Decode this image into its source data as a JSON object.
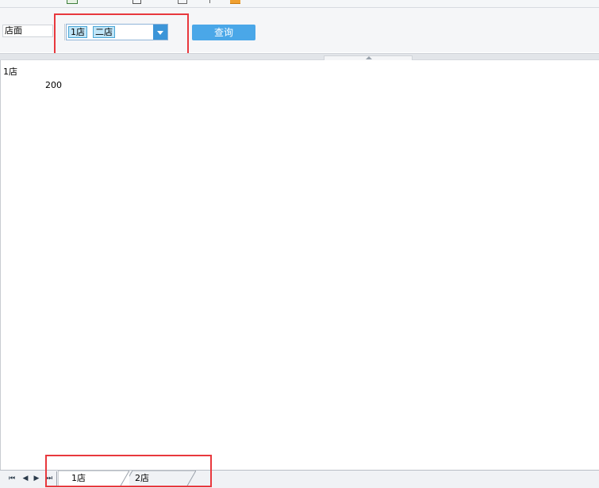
{
  "toolbar": {
    "icons": [
      "export-icon",
      "page-icon",
      "edit-icon",
      "print-icon",
      "folder-icon"
    ]
  },
  "params": {
    "label": "店面",
    "selected_tags": [
      "1店",
      "二店"
    ],
    "query_button": "查询"
  },
  "report": {
    "group_title": "1店",
    "value": "200"
  },
  "sheets": {
    "nav": [
      "first",
      "prev",
      "next",
      "last"
    ],
    "tabs": [
      "1店",
      "2店"
    ],
    "active_tab": "1店"
  },
  "colors": {
    "accent": "#4aa7e8",
    "tag_bg": "#bfe5f8",
    "highlight": "#e8383d"
  }
}
